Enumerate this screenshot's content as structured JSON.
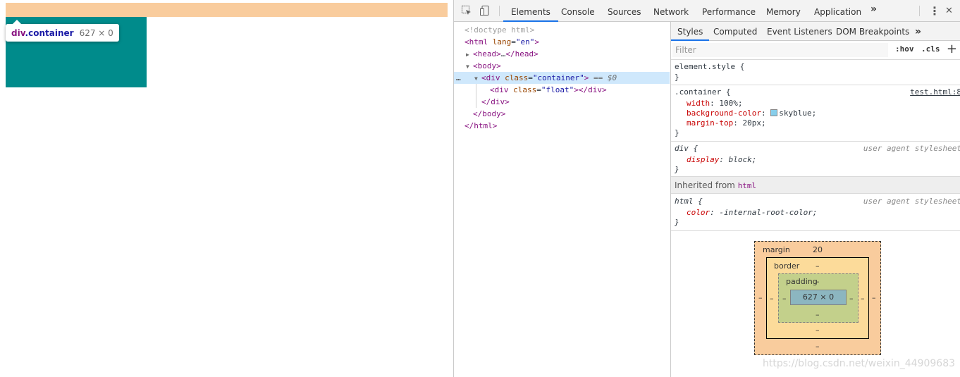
{
  "viewport": {
    "tooltip": {
      "tag": "div",
      "class": ".container",
      "size": "627 × 0"
    },
    "colors": {
      "margin_highlight": "#f9cc9d",
      "float_box": "#008b8b"
    }
  },
  "devtools": {
    "toolbar": {
      "icons": [
        "select-element-icon",
        "device-toggle-icon"
      ],
      "tabs": [
        "Elements",
        "Console",
        "Sources",
        "Network",
        "Performance",
        "Memory",
        "Application"
      ],
      "active_tab": "Elements",
      "more": "»",
      "menu": "⋮",
      "close": "✕"
    },
    "dom": {
      "doctype": "<!doctype html>",
      "html_tag": "html",
      "html_attr_name": "lang",
      "html_attr_value": "\"en\"",
      "head_open": "head",
      "head_ellipsis": "…",
      "head_close": "head",
      "body_tag": "body",
      "div_tag": "div",
      "div_attr_name": "class",
      "div_attr_value": "\"container\"",
      "selected_marker": "== $0",
      "inner_div_attr_value": "\"float\"",
      "dots": "…"
    },
    "styles": {
      "tabs": [
        "Styles",
        "Computed",
        "Event Listeners",
        "DOM Breakpoints"
      ],
      "more": "»",
      "filter_placeholder": "Filter",
      "hov": ":hov",
      "cls": ".cls",
      "add": "+",
      "element_style": "element.style {",
      "close_brace": "}",
      "container_selector": ".container {",
      "container_source": "test.html:8",
      "container_props": [
        {
          "name": "width",
          "value": "100%;"
        },
        {
          "name": "background-color",
          "value": "skyblue;"
        },
        {
          "name": "margin-top",
          "value": "20px;"
        }
      ],
      "div_selector": "div {",
      "ua_label": "user agent stylesheet",
      "div_prop": {
        "name": "display",
        "value": "block;"
      },
      "inherited_label": "Inherited from",
      "inherited_tag": "html",
      "html_selector": "html {",
      "html_prop": {
        "name": "color",
        "value": "-internal-root-color;"
      },
      "swatch_color": "#87ceeb"
    },
    "box_model": {
      "margin_label": "margin",
      "margin_top": "20",
      "border_label": "border",
      "padding_label": "padding",
      "content": "627 × 0",
      "dash": "–"
    }
  },
  "watermark": "https://blog.csdn.net/weixin_44909683"
}
